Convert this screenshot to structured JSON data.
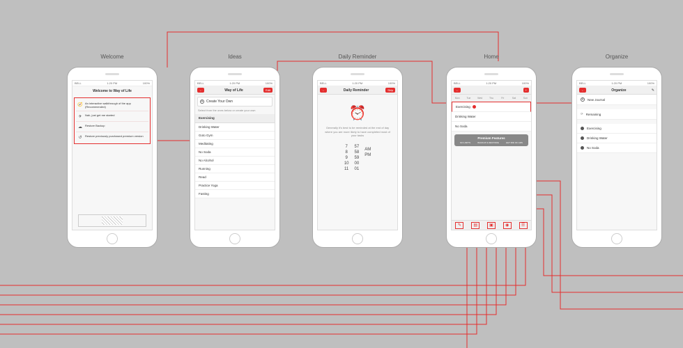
{
  "screens": {
    "welcome": {
      "label": "Welcome",
      "status": {
        "carrier": "BELL",
        "time": "1:20 PM",
        "bat": "100%"
      },
      "title": "Welcome to Way of Life",
      "rows": [
        {
          "icon": "🧭",
          "text": "An interactive walkthrough of the app (Recommended)"
        },
        {
          "icon": "✈",
          "text": "Nah, just get me started"
        },
        {
          "icon": "☁",
          "text": "Restore Backup"
        },
        {
          "icon": "↺",
          "text": "Restore previously purchased premium version"
        }
      ]
    },
    "ideas": {
      "label": "Ideas",
      "status": {
        "carrier": "BELL",
        "time": "1:20 PM",
        "bat": "100%"
      },
      "nav": {
        "back": "←",
        "title": "Way of Life",
        "right": "Edit"
      },
      "create": "Create Your Own",
      "sub": "Select from the ones below or create your own",
      "section": "Exercising",
      "items": [
        "Drinking Water",
        "Goto Gym",
        "Meditating",
        "No Soda",
        "No Alcohol",
        "Running",
        "Read",
        "Practice Yoga",
        "Fasting"
      ]
    },
    "reminder": {
      "label": "Daily Reminder",
      "status": {
        "carrier": "BELL",
        "time": "1:20 PM",
        "bat": "100%"
      },
      "nav": {
        "back": "←",
        "title": "Daily Reminder",
        "right": "Skip"
      },
      "desc": "Generally it's best to be reminded at the end of day where you are more likely to have completed most of your tasks",
      "picker": {
        "hours": [
          "7",
          "8",
          "9",
          "10",
          "11"
        ],
        "mins": [
          "57",
          "58",
          "59",
          "00",
          "01"
        ],
        "ampm": [
          "",
          "",
          "AM",
          "PM",
          ""
        ]
      }
    },
    "home": {
      "label": "Home",
      "status": {
        "carrier": "BELL",
        "time": "1:20 PM",
        "bat": "100%"
      },
      "nav": {
        "back": "←",
        "title": "",
        "right": "+"
      },
      "days": [
        "Mon",
        "Tue",
        "Wed",
        "Thu",
        "Fri",
        "Sat",
        "Sun"
      ],
      "rows": [
        {
          "name": "Exercising",
          "hl": true
        },
        {
          "name": "Drinking Water"
        },
        {
          "name": "No Soda"
        }
      ],
      "premium": {
        "title": "Premium Features",
        "items": [
          "NO LIMITS",
          "BACKUP & RESTORE",
          "GET RID OF ADS"
        ]
      },
      "toolbar": [
        "✎",
        "▤",
        "▣",
        "◉",
        "☰"
      ]
    },
    "organize": {
      "label": "Organize",
      "status": {
        "carrier": "BELL",
        "time": "1:20 PM",
        "bat": "100%"
      },
      "nav": {
        "back": "←",
        "title": "Organize",
        "right": "✎"
      },
      "top": [
        "New Journal"
      ],
      "mid_label": "Remaining",
      "items": [
        "Exercising",
        "Drinking Water",
        "No Soda"
      ]
    }
  }
}
